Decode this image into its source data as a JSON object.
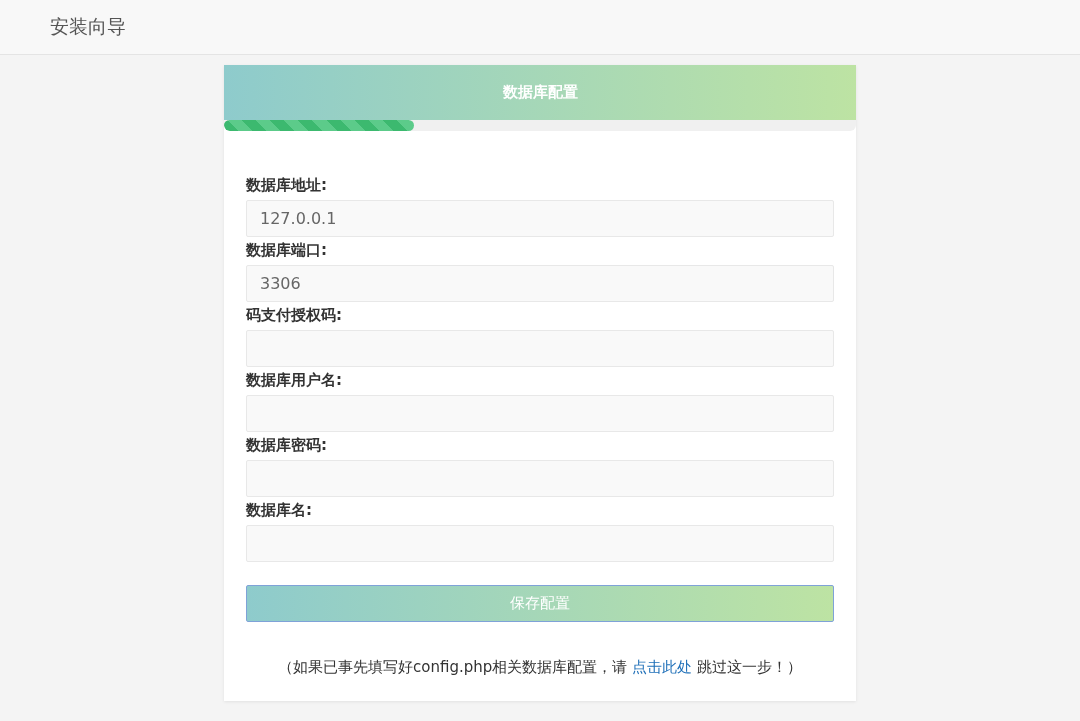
{
  "header": {
    "title": "安装向导"
  },
  "card": {
    "title": "数据库配置",
    "progress": {
      "level": 0.3
    }
  },
  "fields": [
    {
      "label": "数据库地址:",
      "value": "127.0.0.1"
    },
    {
      "label": "数据库端口:",
      "value": "3306"
    },
    {
      "label": "码支付授权码:"
    },
    {
      "label": "数据库用户名:"
    },
    {
      "label": "数据库密码:"
    },
    {
      "label": "数据库名:"
    }
  ],
  "submit": "保存配置",
  "note": {
    "before": "（如果已事先填写好config.php相关数据库配置，请 ",
    "link": "点击此处",
    "after": " 跳过这一步！）"
  }
}
